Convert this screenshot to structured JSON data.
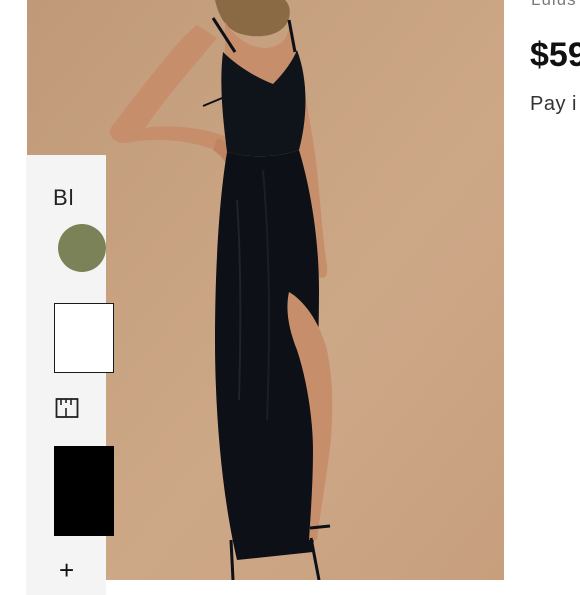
{
  "product": {
    "brand_partial": "Lulus",
    "price": "$59",
    "pay_text": "Pay i",
    "color_label": "Bl",
    "image_alt": "Model wearing a long black wrap maxi dress with a high side slit"
  },
  "colors": {
    "photo_background": "#c8a583",
    "dress": "#0d1016",
    "skin": "#c68e6b",
    "swatch_olive": "#7c8257",
    "options_panel": "#f4f4f4",
    "button_black": "#000000"
  },
  "icons": {
    "size_guide": "ruler-icon",
    "add": "plus-icon"
  }
}
